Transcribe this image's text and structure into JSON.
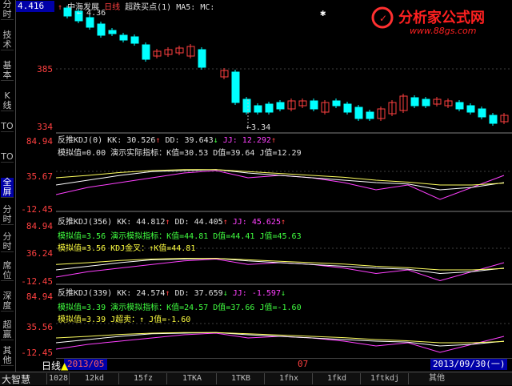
{
  "top_value": "4.416",
  "title": {
    "stock": "中海发展",
    "period": "日线",
    "indicator": "超跌买点(1)",
    "ma": "MA5:",
    "mc": "MC:"
  },
  "left_tabs": [
    "分时",
    "技术",
    "基本",
    "K线",
    "TO",
    "TO",
    "全屏",
    "分时",
    "分时",
    "席位",
    "深度",
    "超赢",
    "其他"
  ],
  "price_axis": {
    "high": "4.36",
    "mid": "385",
    "low": "334",
    "low_marker": "3.34"
  },
  "logo": {
    "text": "分析家公式网",
    "url": "www.88gs.com"
  },
  "panels": [
    {
      "header": "反推KDJ(0)",
      "kk": "KK: 30.526",
      "kk_arrow": "↑",
      "dd": "DD: 39.643",
      "dd_arrow": "↓",
      "jj": "JJ: 12.292",
      "jj_arrow": "↑",
      "line1": "模拟值=0.00 演示实际指标：K值=30.53 D值=39.64 J值=12.29",
      "line2": "",
      "axis": [
        "84.94",
        "35.67",
        "-12.45"
      ]
    },
    {
      "header": "反推KDJ(356)",
      "kk": "KK: 44.812",
      "kk_arrow": "↑",
      "dd": "DD: 44.405",
      "dd_arrow": "↑",
      "jj": "JJ: 45.625",
      "jj_arrow": "↑",
      "line1": "模拟值=3.56 演示模拟指标：K值=44.81 D值=44.41 J值=45.63",
      "line2": "模拟值=3.56 KDJ金叉：↑K值=44.81",
      "axis": [
        "84.94",
        "36.24",
        "-12.45"
      ]
    },
    {
      "header": "反推KDJ(339)",
      "kk": "KK: 24.574",
      "kk_arrow": "↑",
      "dd": "DD: 37.659",
      "dd_arrow": "↓",
      "jj": "JJ: -1.597",
      "jj_arrow": "↓",
      "line1": "模拟值=3.39 演示模拟指标：K值=24.57 D值=37.66 J值=-1.60",
      "line2": "模拟值=3.39   J超卖：↑     J值=-1.60",
      "axis": [
        "84.94",
        "35.56",
        "-12.45"
      ]
    }
  ],
  "dates": {
    "start": "2013/05",
    "mid": "07",
    "end": "2013/09/30(一)"
  },
  "bottom": {
    "brand": "大智慧",
    "period": "日线",
    "tabs": [
      "1028",
      "12kd",
      "15fz",
      "1TKA",
      "1TKB",
      "1fhx",
      "1fkd",
      "1ftkdj",
      "其他"
    ]
  },
  "chart_data": {
    "type": "candlestick",
    "price_range": [
      3.34,
      4.36
    ],
    "kdj_range": [
      -12.45,
      84.94
    ]
  }
}
